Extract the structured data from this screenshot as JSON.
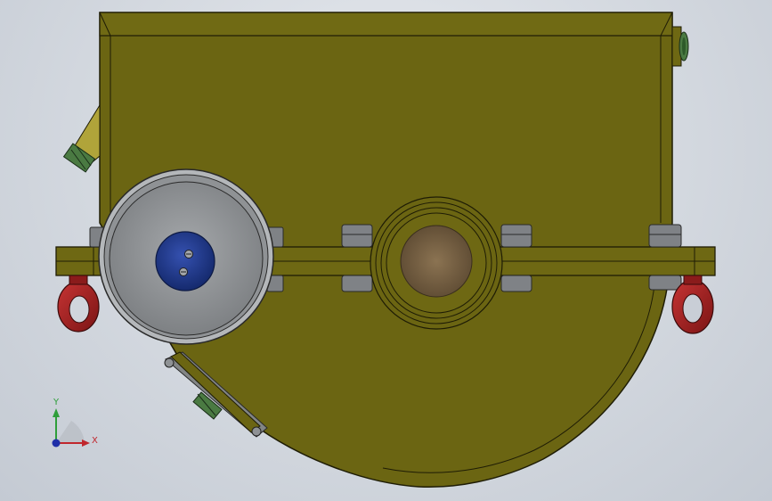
{
  "viewport": {
    "background_top": "#e6e9ee",
    "background_bottom": "#c4cad3"
  },
  "model": {
    "body_color": "#6b6512",
    "body_stroke": "#1e1c05",
    "bolt_color": "#8c8f92",
    "eyebolt_color": "#a11e1e",
    "pulley_outer_color": "#aeb1b4",
    "pulley_inner_color": "#8f9295",
    "hub_color": "#1f3a8a",
    "shaft_core_color": "#7a6446",
    "fitting_color": "#4a7a42"
  },
  "triad": {
    "x_label": "X",
    "y_label": "Y",
    "x_color": "#c0272d",
    "y_color": "#2e9e3a",
    "z_color": "#1f2fa8"
  }
}
